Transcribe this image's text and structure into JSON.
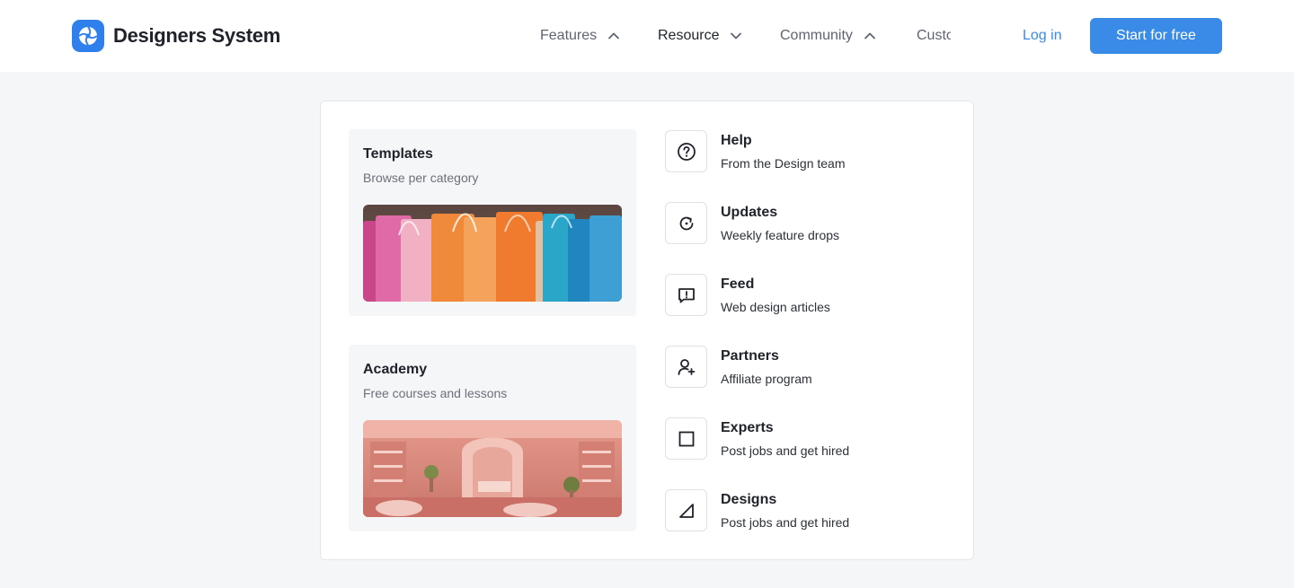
{
  "brand": {
    "name": "Designers System"
  },
  "nav": {
    "items": [
      {
        "label": "Features",
        "icon": "chevron-up-icon"
      },
      {
        "label": "Resource",
        "icon": "chevron-down-icon"
      },
      {
        "label": "Community",
        "icon": "chevron-up-icon"
      },
      {
        "label": "Custo",
        "icon": ""
      }
    ],
    "login": "Log in",
    "cta": "Start for free"
  },
  "menu": {
    "cards": [
      {
        "title": "Templates",
        "subtitle": "Browse per category",
        "image": "shopping-bags-image"
      },
      {
        "title": "Academy",
        "subtitle": "Free courses and lessons",
        "image": "pink-store-interior-image"
      }
    ],
    "items": [
      {
        "title": "Help",
        "subtitle": "From the Design team",
        "icon": "help-circle-icon"
      },
      {
        "title": "Updates",
        "subtitle": "Weekly feature drops",
        "icon": "refresh-icon"
      },
      {
        "title": "Feed",
        "subtitle": "Web design articles",
        "icon": "message-alert-icon"
      },
      {
        "title": "Partners",
        "subtitle": "Affiliate program",
        "icon": "user-plus-icon"
      },
      {
        "title": "Experts",
        "subtitle": "Post jobs and get hired",
        "icon": "square-icon"
      },
      {
        "title": "Designs",
        "subtitle": "Post jobs and get hired",
        "icon": "triangle-icon"
      }
    ]
  },
  "colors": {
    "accent": "#3a8be8",
    "brand": "#2f80ed",
    "background": "#f5f6f8"
  }
}
